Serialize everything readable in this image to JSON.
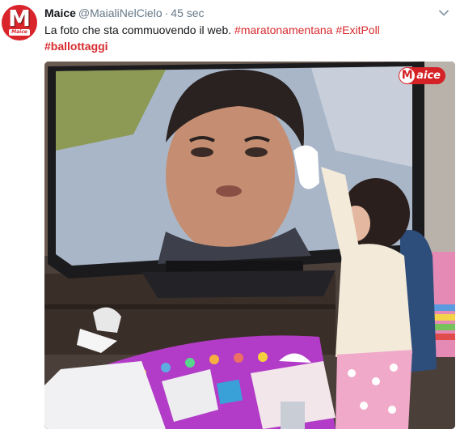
{
  "tweet": {
    "display_name": "Maice",
    "handle": "@MaialiNelCielo",
    "separator": "·",
    "timestamp": "45 sec",
    "text_plain": "La foto che sta commuovendo il web.",
    "hashtags": [
      "#maratonamentana",
      "#ExitPoll",
      "#ballottaggi"
    ],
    "icons": {
      "avatar": "maice-logo-avatar",
      "menu": "chevron-down-icon"
    },
    "colors": {
      "hashtag": "#d72a2e",
      "name": "#14171a",
      "meta": "#657786",
      "brand": "#d9242b"
    }
  },
  "avatar": {
    "letter": "M",
    "word": "Maice"
  },
  "media": {
    "watermark_letter": "M",
    "watermark_text": "aice"
  }
}
